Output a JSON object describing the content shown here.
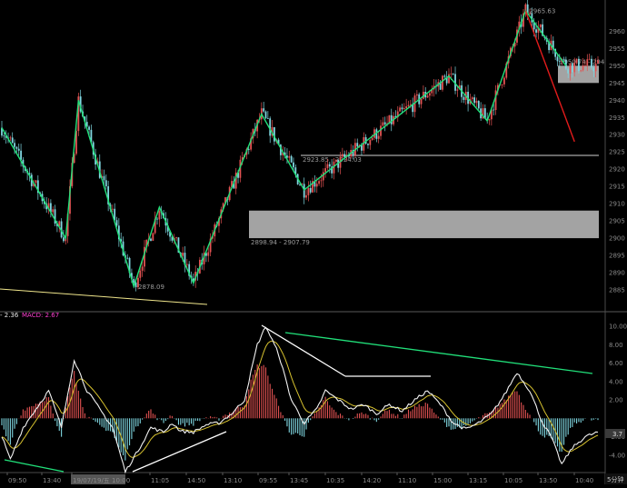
{
  "chart_data": [
    {
      "type": "candlestick",
      "title": "",
      "ylim": [
        2880,
        2968
      ],
      "y_ticks": [
        "2960",
        "2955",
        "2950",
        "2945",
        "2940",
        "2935",
        "2930",
        "2925",
        "2920",
        "2915",
        "2910",
        "2905",
        "2900",
        "2895",
        "2890",
        "2885"
      ],
      "zigzag_pivots": [
        {
          "i": 0,
          "y": 2932
        },
        {
          "i": 30,
          "y": 2900
        },
        {
          "i": 36,
          "y": 2940
        },
        {
          "i": 62,
          "y": 2886
        },
        {
          "i": 74,
          "y": 2909
        },
        {
          "i": 90,
          "y": 2887
        },
        {
          "i": 122,
          "y": 2936
        },
        {
          "i": 142,
          "y": 2914
        },
        {
          "i": 210,
          "y": 2947
        },
        {
          "i": 228,
          "y": 2934
        },
        {
          "i": 246,
          "y": 2966
        },
        {
          "i": 265,
          "y": 2950
        }
      ],
      "down_leg": {
        "i_from": 246,
        "y_from": 2966,
        "i_to": 269,
        "y_to": 2928
      },
      "zones": [
        {
          "label": "2898.94 - 2907.79",
          "low": 2900,
          "high": 2908
        },
        {
          "label": "2950.74 - 294",
          "low": 2945,
          "high": 2950
        }
      ],
      "levels": [
        {
          "label": "2923.85 - 2924.03",
          "value": 2924
        }
      ],
      "annotations": [
        {
          "text": "2965.63",
          "value": 2966
        },
        {
          "text": "2878.09",
          "value": 2886
        }
      ]
    },
    {
      "type": "line",
      "title": "MACD",
      "header": {
        "label_a": "- 2.36",
        "label_b": "MACD: 2.67"
      },
      "ylim": [
        -5.5,
        10.5
      ],
      "y_ticks": [
        "10.00",
        "8.00",
        "6.00",
        "4.00",
        "2.00",
        "-2.00",
        "-4.00"
      ],
      "current_value_tag": "3.7",
      "pivots": [
        {
          "i": 0,
          "y": -2
        },
        {
          "i": 4,
          "y": -4.5
        },
        {
          "i": 10,
          "y": -1
        },
        {
          "i": 16,
          "y": 1
        },
        {
          "i": 22,
          "y": 3
        },
        {
          "i": 28,
          "y": -1
        },
        {
          "i": 34,
          "y": 6.4
        },
        {
          "i": 40,
          "y": 3
        },
        {
          "i": 46,
          "y": 1
        },
        {
          "i": 52,
          "y": -1
        },
        {
          "i": 58,
          "y": -5.8
        },
        {
          "i": 64,
          "y": -3.5
        },
        {
          "i": 70,
          "y": -1
        },
        {
          "i": 76,
          "y": -1.5
        },
        {
          "i": 80,
          "y": -0.5
        },
        {
          "i": 84,
          "y": -1.4
        },
        {
          "i": 90,
          "y": -1.5
        },
        {
          "i": 96,
          "y": -0.7
        },
        {
          "i": 102,
          "y": -0.5
        },
        {
          "i": 108,
          "y": 0.5
        },
        {
          "i": 114,
          "y": 2
        },
        {
          "i": 120,
          "y": 8
        },
        {
          "i": 124,
          "y": 10
        },
        {
          "i": 130,
          "y": 7
        },
        {
          "i": 136,
          "y": 2
        },
        {
          "i": 142,
          "y": -0.5
        },
        {
          "i": 148,
          "y": 1
        },
        {
          "i": 152,
          "y": 3
        },
        {
          "i": 158,
          "y": 2
        },
        {
          "i": 164,
          "y": 1
        },
        {
          "i": 170,
          "y": 1.5
        },
        {
          "i": 176,
          "y": 0.5
        },
        {
          "i": 182,
          "y": 1.5
        },
        {
          "i": 188,
          "y": 0.8
        },
        {
          "i": 194,
          "y": 2
        },
        {
          "i": 200,
          "y": 3
        },
        {
          "i": 206,
          "y": 1.5
        },
        {
          "i": 212,
          "y": -0.5
        },
        {
          "i": 218,
          "y": -1.2
        },
        {
          "i": 224,
          "y": -0.5
        },
        {
          "i": 230,
          "y": 0.5
        },
        {
          "i": 236,
          "y": 2.5
        },
        {
          "i": 242,
          "y": 5
        },
        {
          "i": 248,
          "y": 3
        },
        {
          "i": 254,
          "y": -0.5
        },
        {
          "i": 258,
          "y": -2
        },
        {
          "i": 263,
          "y": -5
        },
        {
          "i": 268,
          "y": -3.2
        },
        {
          "i": 274,
          "y": -2
        },
        {
          "i": 280,
          "y": -1.5
        }
      ]
    }
  ],
  "x_labels": [
    "09:50",
    "13:40",
    "19/07/19/五 10:00",
    "11:05",
    "14:50",
    "13:10",
    "09:55",
    "13:45",
    "10:35",
    "14:20",
    "11:10",
    "15:00",
    "13:15",
    "10:05",
    "13:50",
    "10:40"
  ],
  "corner_label": "5分钟"
}
